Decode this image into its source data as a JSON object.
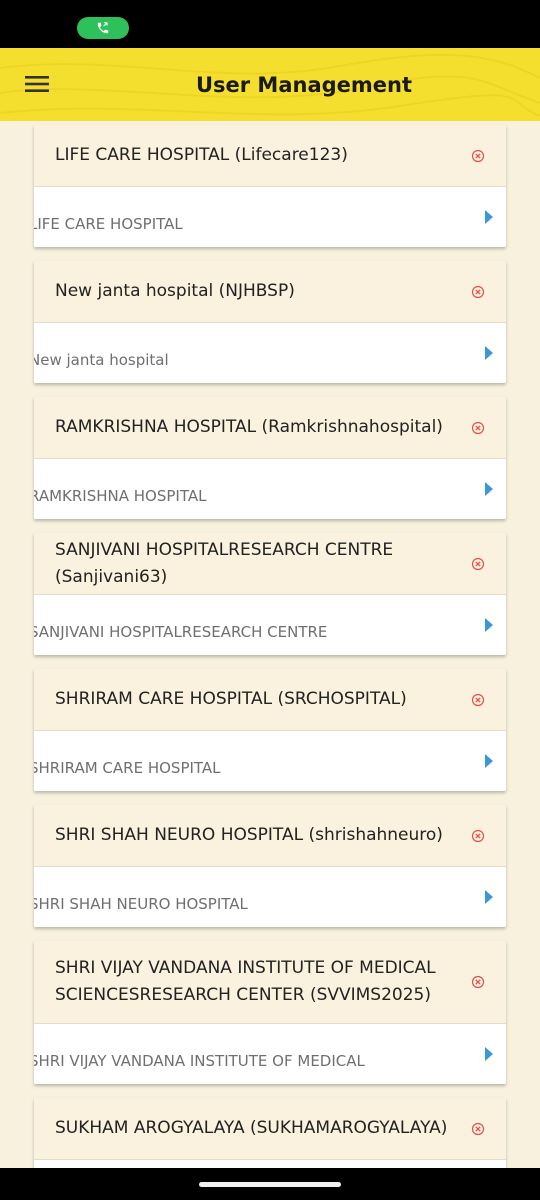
{
  "app_bar": {
    "title": "User Management",
    "background": "#f5df2e"
  },
  "status_bar": {
    "call_indicator": "phone-icon"
  },
  "colors": {
    "page_background": "#f8f1de",
    "remove_icon": "#d9534f",
    "chevron": "#3b98d6"
  },
  "users": [
    {
      "title": "LIFE CARE HOSPITAL (Lifecare123)",
      "subtitle": "LIFE CARE HOSPITAL"
    },
    {
      "title": "New janta hospital (NJHBSP)",
      "subtitle": "New janta hospital"
    },
    {
      "title": "RAMKRISHNA HOSPITAL (Ramkrishnahospital)",
      "subtitle": "RAMKRISHNA HOSPITAL"
    },
    {
      "title": "SANJIVANI HOSPITALRESEARCH CENTRE (Sanjivani63)",
      "subtitle": "SANJIVANI HOSPITALRESEARCH CENTRE"
    },
    {
      "title": "SHRIRAM CARE HOSPITAL (SRCHOSPITAL)",
      "subtitle": "SHRIRAM CARE HOSPITAL"
    },
    {
      "title": "SHRI SHAH NEURO HOSPITAL (shrishahneuro)",
      "subtitle": "SHRI SHAH NEURO HOSPITAL"
    },
    {
      "title": "SHRI VIJAY VANDANA INSTITUTE OF MEDICAL SCIENCESRESEARCH CENTER (SVVIMS2025)",
      "subtitle": "SHRI VIJAY VANDANA INSTITUTE OF MEDICAL"
    },
    {
      "title": "SUKHAM AROGYALAYA (SUKHAMAROGYALAYA)",
      "subtitle": ""
    }
  ]
}
